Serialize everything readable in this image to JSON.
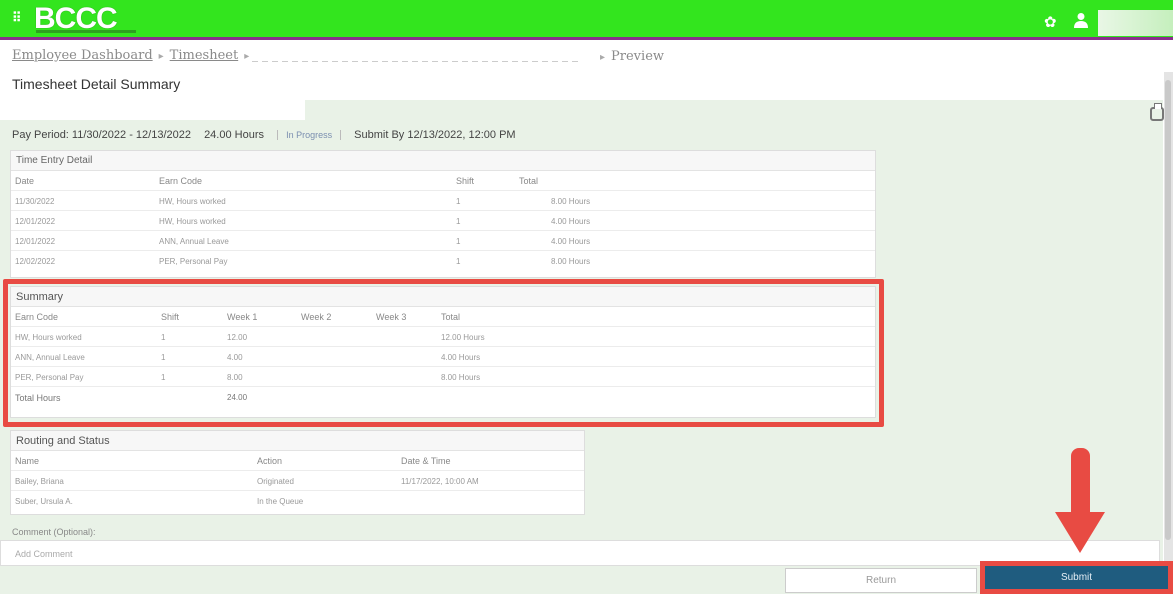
{
  "header": {
    "logo": "BCCC",
    "menu_glyph": "⠿",
    "gear_glyph": "✿",
    "user_glyph": "⬤"
  },
  "breadcrumb": {
    "items": [
      "Employee Dashboard",
      "Timesheet"
    ],
    "sep": "▸",
    "last": "Preview"
  },
  "page": {
    "title": "Timesheet Detail Summary"
  },
  "pay": {
    "period": "Pay Period: 11/30/2022 - 12/13/2022",
    "hours": "24.00 Hours",
    "status": "In Progress",
    "submit_by": "Submit By 12/13/2022, 12:00 PM"
  },
  "time_entry": {
    "title": "Time Entry Detail",
    "headers": [
      "Date",
      "Earn Code",
      "Shift",
      "Total"
    ],
    "rows": [
      [
        "11/30/2022",
        "HW, Hours worked",
        "1",
        "8.00 Hours"
      ],
      [
        "12/01/2022",
        "HW, Hours worked",
        "1",
        "4.00 Hours"
      ],
      [
        "12/01/2022",
        "ANN, Annual Leave",
        "1",
        "4.00 Hours"
      ],
      [
        "12/02/2022",
        "PER, Personal Pay",
        "1",
        "8.00 Hours"
      ]
    ]
  },
  "summary": {
    "title": "Summary",
    "headers": [
      "Earn Code",
      "Shift",
      "Week 1",
      "Week 2",
      "Week 3",
      "Total"
    ],
    "rows": [
      [
        "HW, Hours worked",
        "1",
        "12.00",
        "",
        "",
        "12.00 Hours"
      ],
      [
        "ANN, Annual Leave",
        "1",
        "4.00",
        "",
        "",
        "4.00 Hours"
      ],
      [
        "PER, Personal Pay",
        "1",
        "8.00",
        "",
        "",
        "8.00 Hours"
      ]
    ],
    "total_label": "Total Hours",
    "total_value": "24.00"
  },
  "routing": {
    "title": "Routing and Status",
    "headers": [
      "Name",
      "Action",
      "Date & Time"
    ],
    "rows": [
      [
        "Bailey, Briana",
        "Originated",
        "11/17/2022, 10:00 AM"
      ],
      [
        "Suber, Ursula A.",
        "In the Queue",
        ""
      ]
    ]
  },
  "comment": {
    "label": "Comment (Optional):",
    "placeholder": "Add Comment"
  },
  "actions": {
    "return_label": "Return",
    "submit_label": "Submit"
  },
  "colors": {
    "topbar": "#33e51e",
    "accent_bar": "#8a2f8c",
    "submit": "#1f5c7f",
    "highlight": "#e84b43"
  }
}
